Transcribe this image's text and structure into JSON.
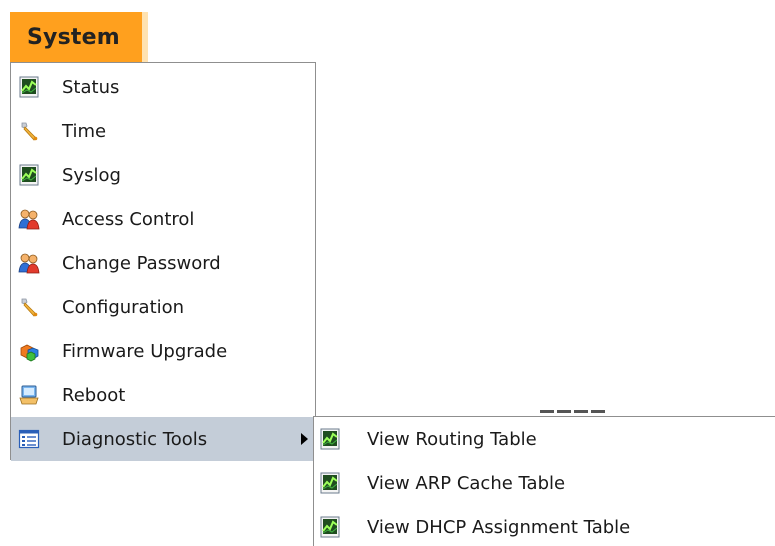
{
  "tab": {
    "label": "System",
    "color": "#ffa01e"
  },
  "menu": {
    "items": [
      {
        "label": "Status",
        "icon": "chart-document-icon"
      },
      {
        "label": "Time",
        "icon": "wrench-icon"
      },
      {
        "label": "Syslog",
        "icon": "chart-document-icon"
      },
      {
        "label": "Access Control",
        "icon": "users-icon"
      },
      {
        "label": "Change Password",
        "icon": "users-icon"
      },
      {
        "label": "Configuration",
        "icon": "wrench-icon"
      },
      {
        "label": "Firmware Upgrade",
        "icon": "cubes-icon"
      },
      {
        "label": "Reboot",
        "icon": "computer-icon"
      },
      {
        "label": "Diagnostic Tools",
        "icon": "list-window-icon",
        "has_submenu": true,
        "active": true
      }
    ],
    "active_color": "#c4cdd8"
  },
  "submenu": {
    "items": [
      {
        "label": "View Routing Table",
        "icon": "chart-document-icon"
      },
      {
        "label": "View ARP Cache Table",
        "icon": "chart-document-icon"
      },
      {
        "label": "View DHCP Assignment Table",
        "icon": "chart-document-icon"
      }
    ]
  }
}
